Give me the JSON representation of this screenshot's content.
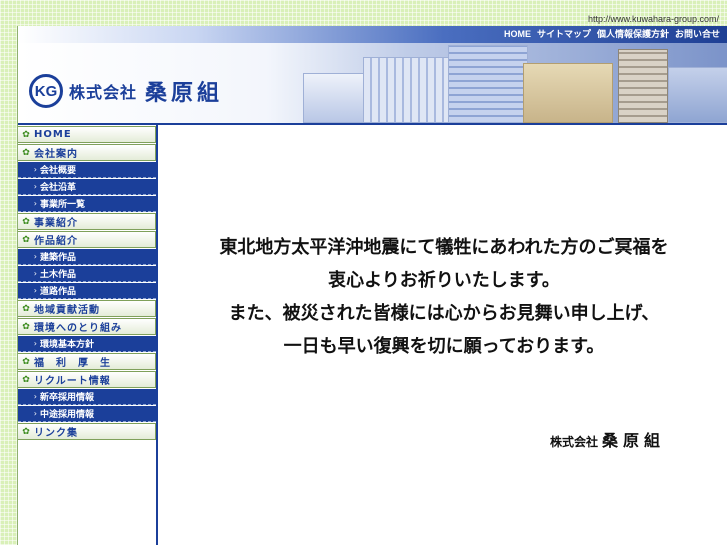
{
  "url_line": "http://www.kuwahara-group.com/",
  "topnav": [
    "HOME",
    "サイトマップ",
    "個人情報保護方針",
    "お問い合せ"
  ],
  "logo": {
    "mark": "KG",
    "prefix": "株式会社",
    "name": "桑原組"
  },
  "sidebar": {
    "items": [
      {
        "label": "HOME",
        "type": "main"
      },
      {
        "label": "会社案内",
        "type": "main"
      },
      {
        "label": "会社概要",
        "type": "sub"
      },
      {
        "label": "会社沿革",
        "type": "sub"
      },
      {
        "label": "事業所一覧",
        "type": "sub"
      },
      {
        "label": "事業紹介",
        "type": "main"
      },
      {
        "label": "作品紹介",
        "type": "main"
      },
      {
        "label": "建築作品",
        "type": "sub"
      },
      {
        "label": "土木作品",
        "type": "sub"
      },
      {
        "label": "道路作品",
        "type": "sub"
      },
      {
        "label": "地域貢献活動",
        "type": "main"
      },
      {
        "label": "環境へのとり組み",
        "type": "main"
      },
      {
        "label": "環境基本方針",
        "type": "sub"
      },
      {
        "label": "福　利　厚　生",
        "type": "main"
      },
      {
        "label": "リクルート情報",
        "type": "main"
      },
      {
        "label": "新卒採用情報",
        "type": "sub"
      },
      {
        "label": "中途採用情報",
        "type": "sub"
      },
      {
        "label": "リンク集",
        "type": "main"
      }
    ]
  },
  "message": {
    "lines": [
      "東北地方太平洋沖地震にて犠牲にあわれた方のご冥福を",
      "衷心よりお祈りいたします。",
      "また、被災された皆様には心からお見舞い申し上げ、",
      "一日も早い復興を切に願っております。"
    ],
    "signature_prefix": "株式会社",
    "signature_name": "桑原組"
  },
  "colors": {
    "brand_blue": "#1b3f9a",
    "leaf_green": "#3a8a1c",
    "page_green": "#d9f0b8"
  },
  "icons": {
    "main_item": "leaf-icon",
    "sub_item": "arrow-icon"
  }
}
